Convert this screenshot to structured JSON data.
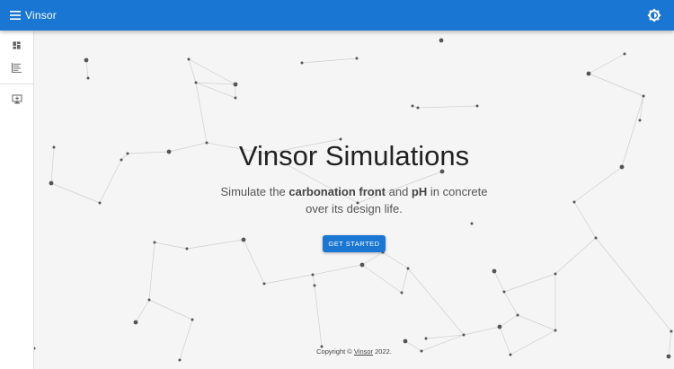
{
  "app": {
    "title": "Vinsor"
  },
  "hero": {
    "title": "Vinsor Simulations",
    "subtitle_part1": "Simulate the ",
    "subtitle_bold1": "carbonation front",
    "subtitle_part2": " and ",
    "subtitle_bold2": "pH",
    "subtitle_part3": " in concrete",
    "subtitle_line2": "over its design life.",
    "cta_label": "GET STARTED"
  },
  "footer": {
    "prefix": "Copyright © ",
    "link": "Vinsor",
    "suffix": " 2022."
  },
  "drawer": {
    "items": [
      {
        "icon": "dashboard-icon"
      },
      {
        "icon": "list-icon"
      },
      {
        "icon": "monitor-icon"
      }
    ]
  },
  "colors": {
    "primary": "#1976d2",
    "background": "#f5f5f5",
    "network_dot": "#555555",
    "network_line": "#cfcfcf"
  }
}
